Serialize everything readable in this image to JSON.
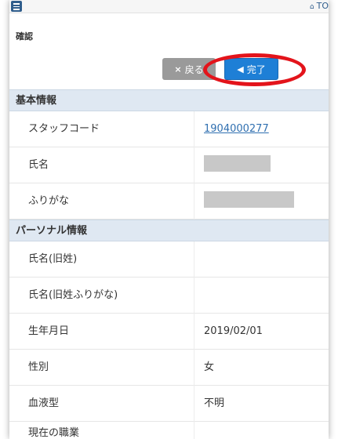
{
  "header": {
    "home_link": "TO"
  },
  "page": {
    "title": "確認"
  },
  "actions": {
    "back_label": "戻る",
    "done_label": "完了"
  },
  "sections": {
    "basic": {
      "title": "基本情報",
      "rows": [
        {
          "label": "スタッフコード",
          "value": "1904000277"
        },
        {
          "label": "氏名",
          "value": ""
        },
        {
          "label": "ふりがな",
          "value": ""
        }
      ]
    },
    "personal": {
      "title": "パーソナル情報",
      "rows": [
        {
          "label": "氏名(旧姓)",
          "value": ""
        },
        {
          "label": "氏名(旧姓ふりがな)",
          "value": ""
        },
        {
          "label": "生年月日",
          "value": "2019/02/01"
        },
        {
          "label": "性別",
          "value": "女"
        },
        {
          "label": "血液型",
          "value": "不明"
        },
        {
          "label": "現在の職業",
          "value": ""
        }
      ]
    }
  },
  "colors": {
    "primary": "#1e7fd6",
    "secondary": "#9a9a9a",
    "annotation": "#e3141b",
    "section_bg": "#dfe8f2",
    "link": "#2f6fb0"
  }
}
